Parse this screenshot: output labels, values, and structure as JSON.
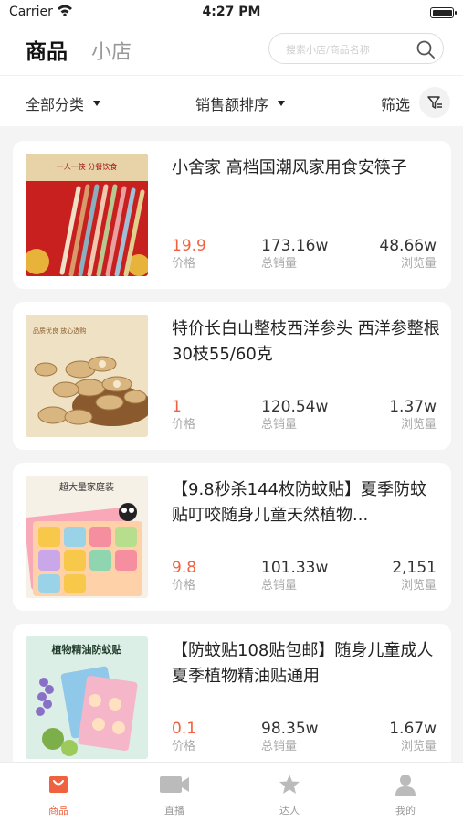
{
  "status": {
    "carrier": "Carrier",
    "time": "4:27 PM"
  },
  "header": {
    "tab_goods": "商品",
    "tab_shop": "小店",
    "search_placeholder": "搜索小店/商品名称"
  },
  "filters": {
    "category": "全部分类",
    "sort": "销售额排序",
    "screen": "筛选"
  },
  "stat_labels": {
    "price": "价格",
    "sales": "总销量",
    "views": "浏览量"
  },
  "products": [
    {
      "title": "小舍家 高档国潮风家用食安筷子",
      "price": "19.9",
      "sales": "173.16w",
      "views": "48.66w",
      "image_text": "一人一筷 分餐饮食"
    },
    {
      "title": "特价长白山整枝西洋参头 西洋参整根30枝55/60克",
      "price": "1",
      "sales": "120.54w",
      "views": "1.37w",
      "image_text": "品质优良 放心选购"
    },
    {
      "title": "【9.8秒杀144枚防蚊贴】夏季防蚊贴叮咬随身儿童天然植物...",
      "price": "9.8",
      "sales": "101.33w",
      "views": "2,151",
      "image_text": "超大量家庭装"
    },
    {
      "title": "【防蚊贴108贴包邮】随身儿童成人夏季植物精油贴通用",
      "price": "0.1",
      "sales": "98.35w",
      "views": "1.67w",
      "image_text": "植物精油防蚊贴"
    }
  ],
  "tabbar": [
    {
      "label": "商品",
      "icon": "bag-icon"
    },
    {
      "label": "直播",
      "icon": "video-icon"
    },
    {
      "label": "达人",
      "icon": "star-person-icon"
    },
    {
      "label": "我的",
      "icon": "user-icon"
    }
  ],
  "colors": {
    "accent": "#f0623f",
    "background": "#f4f4f4"
  }
}
